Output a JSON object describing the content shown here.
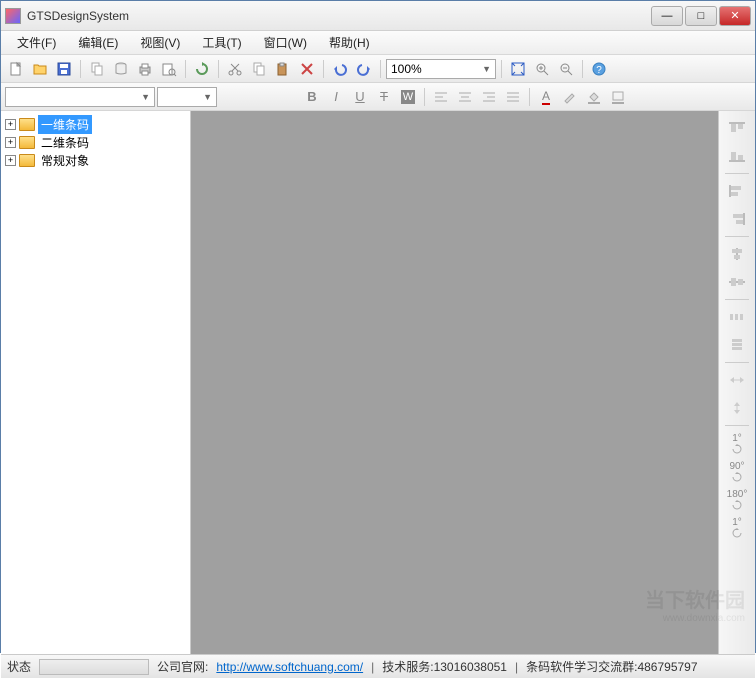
{
  "titlebar": {
    "title": "GTSDesignSystem"
  },
  "menubar": {
    "items": [
      {
        "label": "文件(F)"
      },
      {
        "label": "编辑(E)"
      },
      {
        "label": "视图(V)"
      },
      {
        "label": "工具(T)"
      },
      {
        "label": "窗口(W)"
      },
      {
        "label": "帮助(H)"
      }
    ]
  },
  "toolbar": {
    "zoom_value": "100%"
  },
  "tree": {
    "items": [
      {
        "label": "一维条码",
        "selected": true
      },
      {
        "label": "二维条码",
        "selected": false
      },
      {
        "label": "常规对象",
        "selected": false
      }
    ]
  },
  "right_toolbar": {
    "rotation_labels": [
      "1°",
      "90°",
      "180°",
      "1°"
    ]
  },
  "statusbar": {
    "status_label": "状态",
    "company_label": "公司官网:",
    "company_url": "http://www.softchuang.com/",
    "tech_service": "技术服务:13016038051",
    "qq_group": "条码软件学习交流群:486795797"
  },
  "watermark": {
    "main": "当下软件园",
    "sub": "www.downxia.com"
  }
}
